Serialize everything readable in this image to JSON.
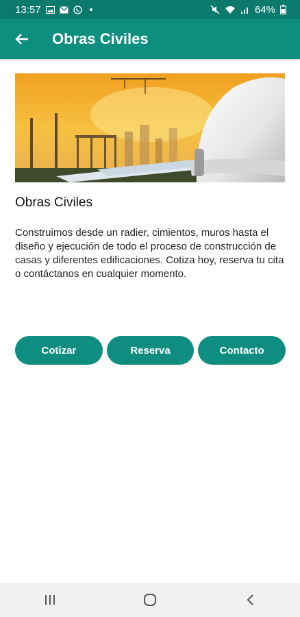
{
  "status": {
    "time": "13:57",
    "battery": "64%",
    "colors": {
      "statusbar": "#0b7a6c",
      "appbar": "#0d8f80",
      "button": "#0f8d80"
    }
  },
  "appbar": {
    "title": "Obras Civiles",
    "back_icon": "arrow-left-icon"
  },
  "content": {
    "heading": "Obras Civiles",
    "description": "Construimos desde un radier, cimientos, muros hasta el diseño y ejecución de todo el proceso de construcción de casas y diferentes edificaciones. Cotiza hoy, reserva tu cita o contáctanos en cualquier momento."
  },
  "buttons": {
    "cotizar": "Cotizar",
    "reserva": "Reserva",
    "contacto": "Contacto"
  },
  "navbar": {
    "recents_icon": "recents-icon",
    "home_icon": "home-icon",
    "back_icon": "back-chevron-icon"
  }
}
